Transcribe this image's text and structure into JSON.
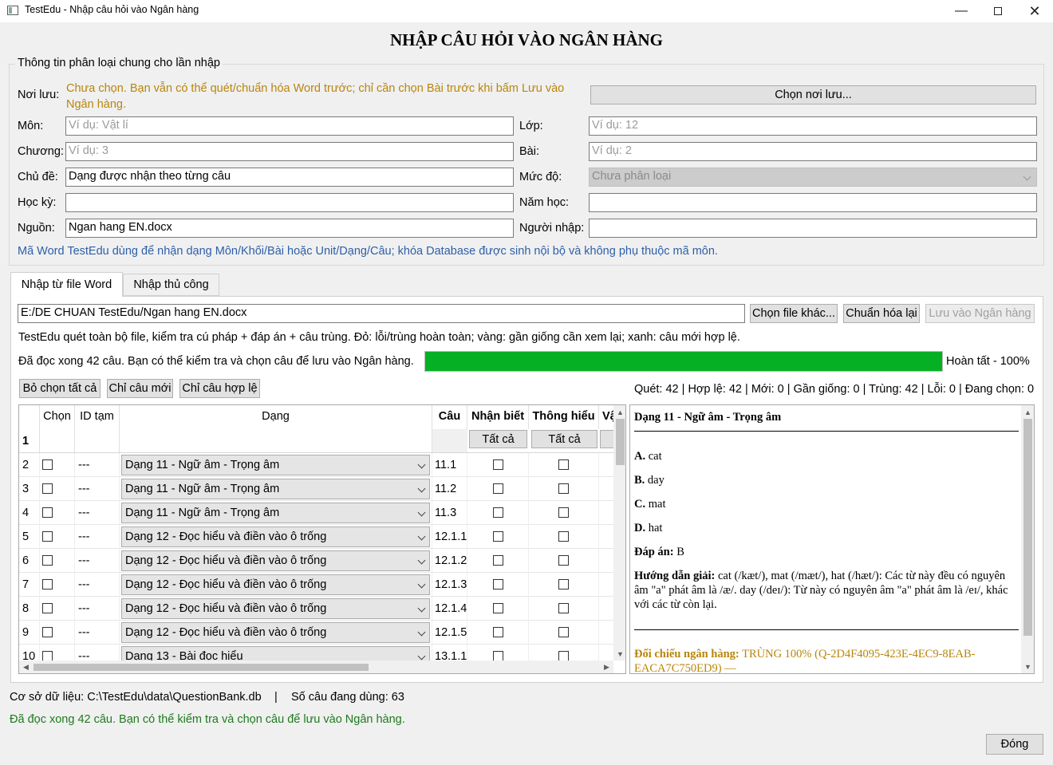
{
  "window": {
    "title": "TestEdu - Nhập câu hỏi vào Ngân hàng"
  },
  "heading": "NHẬP CÂU HỎI VÀO NGÂN HÀNG",
  "group": {
    "legend": "Thông tin phân loại chung cho lần nhập",
    "noi_luu_label": "Nơi lưu:",
    "noi_luu_text": "Chưa chọn. Bạn vẫn có thể quét/chuẩn hóa Word trước; chỉ cần chọn Bài trước khi bấm Lưu vào Ngân hàng.",
    "chon_noi_luu_button": "Chọn nơi lưu...",
    "mon_label": "Môn:",
    "mon_placeholder": "Ví dụ: Vật lí",
    "lop_label": "Lớp:",
    "lop_placeholder": "Ví dụ: 12",
    "chuong_label": "Chương:",
    "chuong_placeholder": "Ví dụ: 3",
    "bai_label": "Bài:",
    "bai_placeholder": "Ví dụ: 2",
    "chu_de_label": "Chủ đề:",
    "chu_de_value": "Dạng được nhận theo từng câu",
    "muc_do_label": "Mức độ:",
    "muc_do_value": "Chưa phân loại",
    "hoc_ky_label": "Học kỳ:",
    "hoc_ky_value": "",
    "nam_hoc_label": "Năm học:",
    "nam_hoc_value": "",
    "nguon_label": "Nguồn:",
    "nguon_value": "Ngan hang EN.docx",
    "nguoi_nhap_label": "Người nhập:",
    "nguoi_nhap_value": "",
    "note": "Mã Word TestEdu dùng để nhận dạng Môn/Khối/Bài hoặc Unit/Dạng/Câu; khóa Database được sinh nội bộ và không phụ thuộc mã môn."
  },
  "tabs": [
    {
      "label": "Nhập từ file Word"
    },
    {
      "label": "Nhập thủ công"
    }
  ],
  "word_tab": {
    "file_path": "E:/DE CHUAN TestEdu/Ngan hang EN.docx",
    "chon_file_button": "Chọn file khác...",
    "chuan_hoa_button": "Chuẩn hóa lại",
    "luu_button": "Lưu vào Ngân hàng",
    "info": "TestEdu quét toàn bộ file, kiểm tra cú pháp + đáp án + câu trùng. Đỏ: lỗi/trùng hoàn toàn; vàng: gần giống cần xem lại; xanh: câu mới hợp lệ.",
    "progress_text": "Đã đọc xong 42 câu. Bạn có thể kiểm tra và chọn câu để lưu vào Ngân hàng.",
    "progress_percent": 100,
    "progress_label": "Hoàn tất - 100%",
    "bo_chon_button": "Bỏ chọn tất cả",
    "chi_cau_moi_button": "Chỉ câu mới",
    "chi_cau_hop_le_button": "Chỉ câu hợp lệ",
    "stats": "Quét: 42 | Hợp lệ: 42 | Mới: 0 | Gần giống: 0 | Trùng: 42 | Lỗi: 0 | Đang chọn: 0"
  },
  "grid": {
    "headers": {
      "chon": "Chọn",
      "id": "ID tạm",
      "dang": "Dạng",
      "cau": "Câu",
      "nhan_biet": "Nhận biết",
      "thong_hieu": "Thông hiểu",
      "van_dung": "Vậ"
    },
    "first_row_num": "1",
    "tat_ca": "Tất cả",
    "rows": [
      {
        "num": "2",
        "id": "---",
        "dang": "Dạng 11 - Ngữ âm - Trọng âm",
        "cau": "11.1"
      },
      {
        "num": "3",
        "id": "---",
        "dang": "Dạng 11 - Ngữ âm - Trọng âm",
        "cau": "11.2"
      },
      {
        "num": "4",
        "id": "---",
        "dang": "Dạng 11 - Ngữ âm - Trọng âm",
        "cau": "11.3"
      },
      {
        "num": "5",
        "id": "---",
        "dang": "Dạng 12 - Đọc hiểu và điền vào ô trống",
        "cau": "12.1.1"
      },
      {
        "num": "6",
        "id": "---",
        "dang": "Dạng 12 - Đọc hiểu và điền vào ô trống",
        "cau": "12.1.2"
      },
      {
        "num": "7",
        "id": "---",
        "dang": "Dạng 12 - Đọc hiểu và điền vào ô trống",
        "cau": "12.1.3"
      },
      {
        "num": "8",
        "id": "---",
        "dang": "Dạng 12 - Đọc hiểu và điền vào ô trống",
        "cau": "12.1.4"
      },
      {
        "num": "9",
        "id": "---",
        "dang": "Dạng 12 - Đọc hiểu và điền vào ô trống",
        "cau": "12.1.5"
      },
      {
        "num": "10",
        "id": "---",
        "dang": "Dạng 13 - Bài đọc hiểu",
        "cau": "13.1.1"
      }
    ]
  },
  "preview": {
    "title": "Dạng 11 - Ngữ âm - Trọng âm",
    "options": [
      {
        "key": "A.",
        "text": " cat"
      },
      {
        "key": "B.",
        "text": " day"
      },
      {
        "key": "C.",
        "text": " mat"
      },
      {
        "key": "D.",
        "text": " hat"
      }
    ],
    "dap_an_label": "Đáp án:",
    "dap_an_value": " B",
    "huong_dan_label": "Hướng dẫn giải:",
    "huong_dan_text": " cat (/kæt/), mat (/mæt/), hat (/hæt/): Các từ này đều có nguyên âm \"a\" phát âm là /æ/. day (/deɪ/): Từ này có nguyên âm \"a\" phát âm là /eɪ/, khác với các từ còn lại.",
    "doi_chieu_label": "Đối chiếu ngân hàng:",
    "doi_chieu_text": " TRÙNG 100% (Q-2D4F4095-423E-4EC9-8EAB-EACA7C750ED9) —"
  },
  "footer": {
    "db_text": "Cơ sở dữ liệu: C:\\TestEdu\\data\\QuestionBank.db",
    "separator": "|",
    "count_text": "Số câu đang dùng: 63",
    "status": "Đã đọc xong 42 câu. Bạn có thể kiểm tra và chọn câu để lưu vào Ngân hàng.",
    "dong_button": "Đóng"
  }
}
